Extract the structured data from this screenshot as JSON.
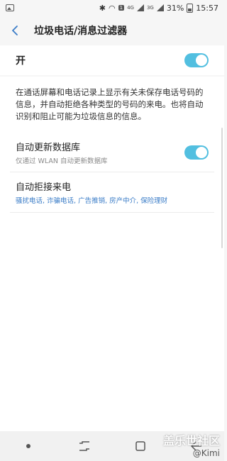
{
  "status_bar": {
    "network_badge": "4G",
    "network_badge2": "3G",
    "battery": "31%",
    "time": "15:57",
    "sim_label": "1"
  },
  "header": {
    "title": "垃圾电话/消息过滤器"
  },
  "master": {
    "label": "开",
    "enabled": true
  },
  "description": "在通话屏幕和电话记录上显示有关未保存电话号码的信息，并自动拒绝各种类型的号码的来电。也将自动识别和阻止可能为垃圾信息的信息。",
  "settings": [
    {
      "title": "自动更新数据库",
      "subtitle": "仅通过 WLAN 自动更新数据库",
      "enabled": true
    },
    {
      "title": "自动拒接来电",
      "subtitle": "骚扰电话, 诈骗电话, 广告推销, 房产中介, 保险理财"
    }
  ],
  "colors": {
    "accent": "#52bfe0",
    "link": "#3a7cc7"
  },
  "watermark": {
    "line1": "盖乐世社区",
    "line2": "@Kimi"
  }
}
